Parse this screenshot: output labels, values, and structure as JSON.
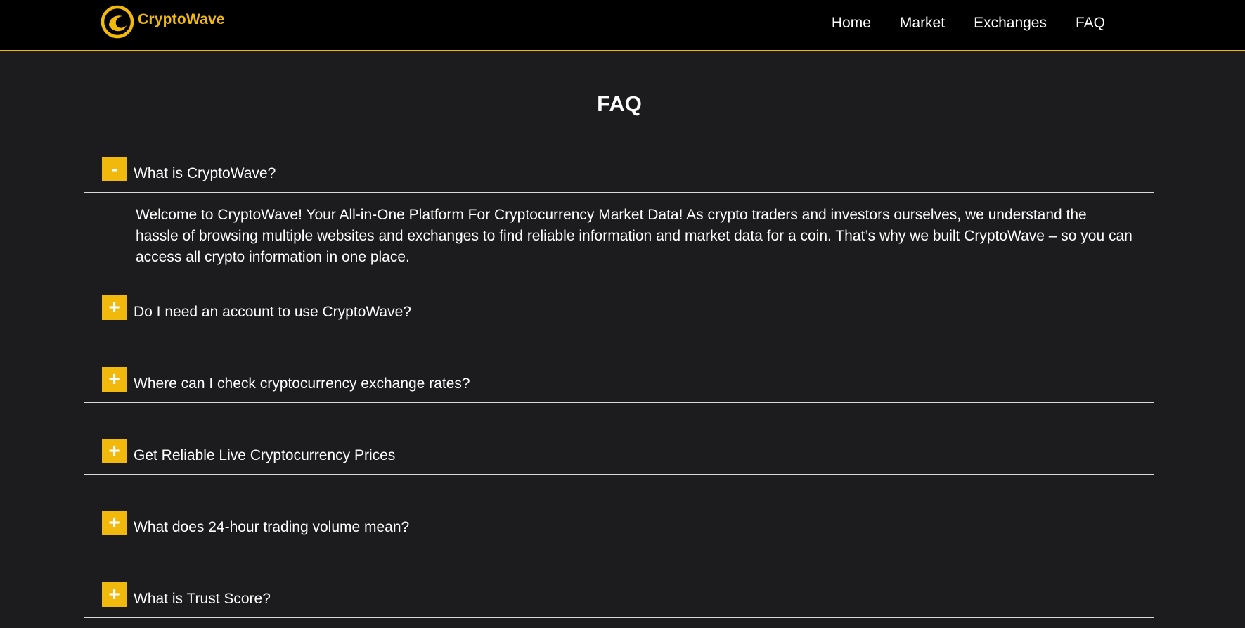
{
  "brand": {
    "name": "CryptoWave",
    "logo_icon": "wave-logo-icon",
    "accent_color": "#f0b90b"
  },
  "nav": {
    "items": [
      {
        "label": "Home"
      },
      {
        "label": "Market"
      },
      {
        "label": "Exchanges"
      },
      {
        "label": "FAQ"
      }
    ]
  },
  "page": {
    "title": "FAQ"
  },
  "faq": {
    "items": [
      {
        "toggle": "-",
        "question": "What is CryptoWave?",
        "expanded": true,
        "answer": "Welcome to CryptoWave! Your All-in-One Platform For Cryptocurrency Market Data! As crypto traders and investors ourselves, we understand the hassle of browsing multiple websites and exchanges to find reliable information and market data for a coin. That’s why we built CryptoWave – so you can access all crypto information in one place."
      },
      {
        "toggle": "+",
        "question": "Do I need an account to use CryptoWave?",
        "expanded": false
      },
      {
        "toggle": "+",
        "question": "Where can I check cryptocurrency exchange rates?",
        "expanded": false
      },
      {
        "toggle": "+",
        "question": "Get Reliable Live Cryptocurrency Prices",
        "expanded": false
      },
      {
        "toggle": "+",
        "question": "What does 24-hour trading volume mean?",
        "expanded": false
      },
      {
        "toggle": "+",
        "question": "What is Trust Score?",
        "expanded": false
      }
    ]
  }
}
